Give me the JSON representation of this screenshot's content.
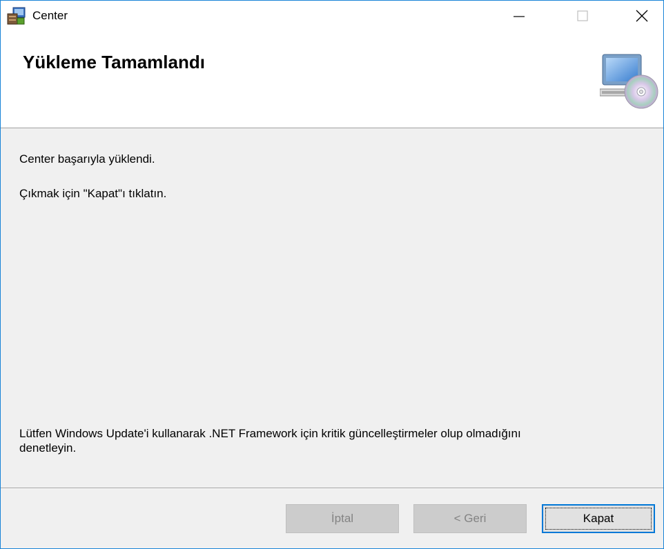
{
  "window": {
    "title": "Center"
  },
  "header": {
    "title": "Yükleme Tamamlandı"
  },
  "main": {
    "line1": "Center başarıyla yüklendi.",
    "line2": "Çıkmak için \"Kapat\"ı tıklatın.",
    "footer_note_line1": "Lütfen Windows Update'i kullanarak .NET Framework için kritik güncelleştirmeler olup olmadığını",
    "footer_note_line2": "denetleyin."
  },
  "buttons": {
    "cancel": {
      "label": "İptal",
      "enabled": false
    },
    "back": {
      "label": "< Geri",
      "enabled": false
    },
    "close": {
      "label": "Kapat",
      "enabled": true,
      "mnemonic": "K"
    }
  },
  "icons": {
    "app": "installer-icon",
    "header": "computer-cd-icon",
    "minimize": "minimize-icon",
    "maximize": "maximize-icon",
    "close": "close-icon"
  },
  "colors": {
    "window_border": "#1883d7",
    "focus": "#0078d7"
  }
}
